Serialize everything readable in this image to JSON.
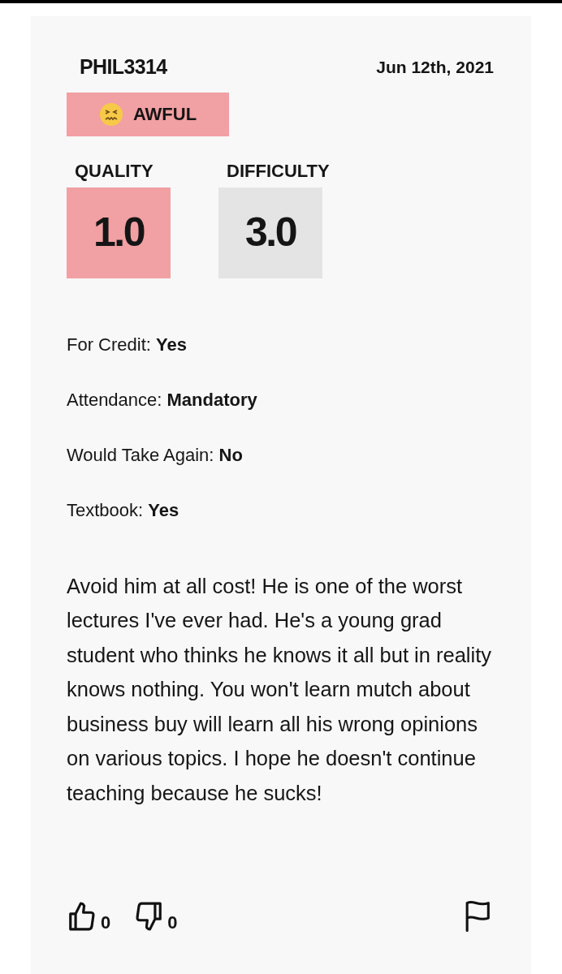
{
  "review": {
    "username": "PHIL3314",
    "date": "Jun 12th, 2021",
    "rating_badge": {
      "label": "AWFUL",
      "color": "#f1a0a3"
    },
    "scores": [
      {
        "label": "QUALITY",
        "value": "1.0",
        "color": "#f1a0a3"
      },
      {
        "label": "DIFFICULTY",
        "value": "3.0",
        "color": "#e4e4e4"
      }
    ],
    "attributes": [
      "For Credit: **Yes**",
      "Attendance: **Mandatory**",
      "Would Take Again: **No**",
      "Textbook: **Yes**"
    ],
    "comment": "Avoid him at all cost! He is one of the worst lectures I've ever had. He's a young grad student who thinks he knows it all but in reality knows nothing. You won't learn mutch about business buy will learn all his wrong opinions on various topics. I hope he doesn't continue teaching because he sucks!",
    "thumbs_up_count": "0",
    "thumbs_down_count": "0"
  }
}
